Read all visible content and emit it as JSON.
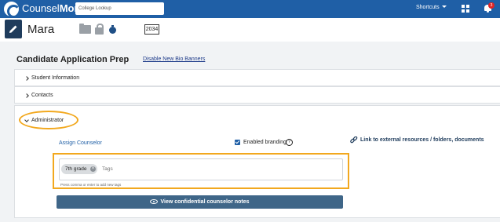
{
  "nav": {
    "brand_light": "Counsel",
    "brand_bold": "More",
    "search_placeholder": "College Lookup",
    "shortcuts_label": "Shortcuts",
    "notification_count": "3"
  },
  "student": {
    "name": "Mara",
    "grad_year": "2034"
  },
  "page": {
    "title": "Candidate Application Prep",
    "disable_banners_link": "Disable New Bio Banners"
  },
  "sections": {
    "student_info": "Student Information",
    "contacts": "Contacts",
    "administrator": "Administrator"
  },
  "admin": {
    "assign_counselor": "Assign Counselor",
    "enabled_branding": "Enabled branding",
    "help_symbol": "?",
    "external_link": "Link to external resources / folders, documents",
    "tags": [
      "7th grade"
    ],
    "tag_remove_symbol": "×",
    "tags_placeholder": "Tags",
    "tags_hint": "Press comma or enter to add new tags",
    "confidential_button": "View confidential counselor notes"
  },
  "colors": {
    "nav_blue": "#1f5fa6",
    "highlight_orange": "#f2a81e",
    "button_blue": "#3f6688",
    "badge_red": "#e02424"
  }
}
